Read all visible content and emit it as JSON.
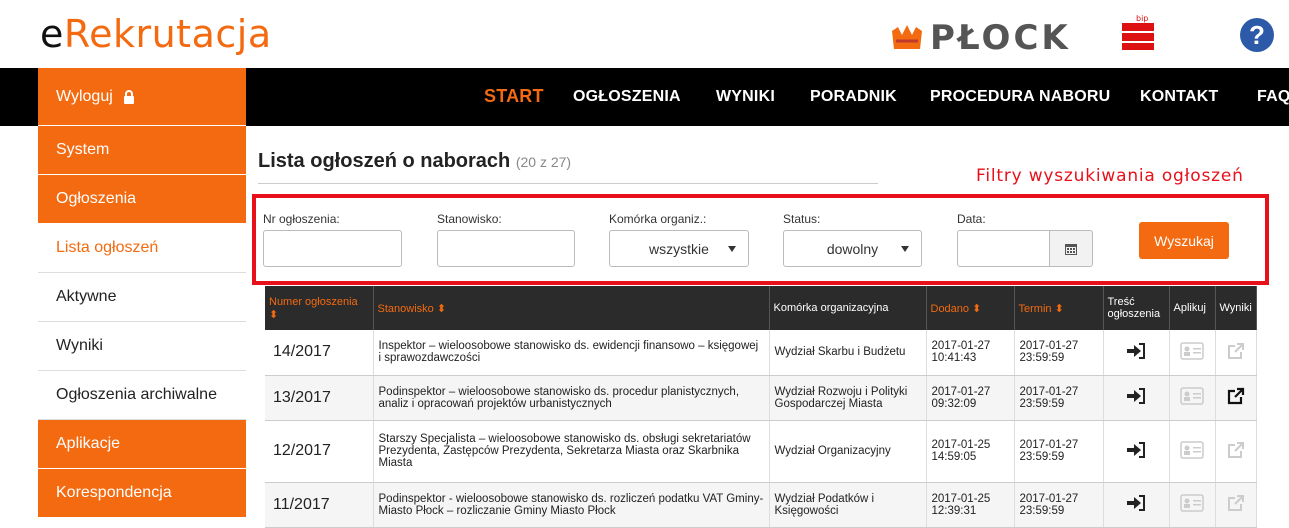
{
  "header": {
    "logo_e": "e",
    "logo_rest": "Rekrutacja",
    "city": "PŁOCK",
    "bip": "bip",
    "help": "?"
  },
  "topnav": [
    "START",
    "OGŁOSZENIA",
    "WYNIKI",
    "PORADNIK",
    "PROCEDURA NABORU",
    "KONTAKT",
    "FAQ"
  ],
  "sidebar": {
    "logout": "Wyloguj",
    "items": [
      "System",
      "Ogłoszenia",
      "Lista ogłoszeń",
      "Aktywne",
      "Wyniki",
      "Ogłoszenia archiwalne",
      "Aplikacje",
      "Korespondencja"
    ]
  },
  "page": {
    "title": "Lista ogłoszeń o naborach",
    "count": "(20 z 27)",
    "filter_label": "Filtry wyszukiwania ogłoszeń"
  },
  "filters": {
    "nr_label": "Nr ogłoszenia:",
    "stanowisko_label": "Stanowisko:",
    "komorka_label": "Komórka organiz.:",
    "komorka_value": "wszystkie",
    "status_label": "Status:",
    "status_value": "dowolny",
    "data_label": "Data:",
    "search_button": "Wyszukaj"
  },
  "table": {
    "headers": [
      "Numer ogłoszenia",
      "Stanowisko",
      "Komórka organizacyjna",
      "Dodano",
      "Termin",
      "Treść ogłoszenia",
      "Aplikuj",
      "Wyniki"
    ],
    "rows": [
      {
        "num": "14/2017",
        "stanowisko": "Inspektor – wieloosobowe stanowisko ds. ewidencji finansowo – księgowej i sprawozdawczości",
        "komorka": "Wydział Skarbu i Budżetu",
        "dodano": "2017-01-27 10:41:43",
        "termin": "2017-01-27 23:59:59",
        "wyniki_active": false
      },
      {
        "num": "13/2017",
        "stanowisko": "Podinspektor – wieloosobowe stanowisko ds. procedur planistycznych, analiz i opracowań projektów urbanistycznych",
        "komorka": "Wydział Rozwoju i Polityki Gospodarczej Miasta",
        "dodano": "2017-01-27 09:32:09",
        "termin": "2017-01-27 23:59:59",
        "wyniki_active": true
      },
      {
        "num": "12/2017",
        "stanowisko": "Starszy Specjalista – wieloosobowe stanowisko ds. obsługi sekretariatów Prezydenta, Zastępców Prezydenta, Sekretarza Miasta oraz Skarbnika Miasta",
        "komorka": "Wydział Organizacyjny",
        "dodano": "2017-01-25 14:59:05",
        "termin": "2017-01-27 23:59:59",
        "wyniki_active": false
      },
      {
        "num": "11/2017",
        "stanowisko": "Podinspektor - wieloosobowe stanowisko ds. rozliczeń podatku VAT Gminy- Miasto Płock – rozliczanie Gminy Miasto Płock",
        "komorka": "Wydział Podatków i Księgowości",
        "dodano": "2017-01-25 12:39:31",
        "termin": "2017-01-27 23:59:59",
        "wyniki_active": false
      }
    ]
  },
  "colors": {
    "accent": "#f36a10",
    "nav_bg": "#000000",
    "highlight": "#e8111b"
  }
}
